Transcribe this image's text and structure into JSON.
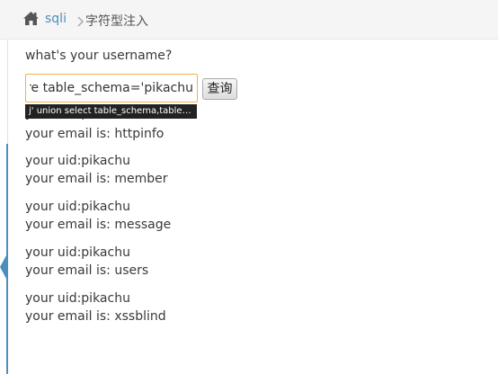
{
  "breadcrumb": {
    "home_icon": "home-icon",
    "link": "sqli",
    "separator_icon": "chevron-right-icon",
    "current": "字符型注入"
  },
  "form": {
    "question": "what's your username?",
    "input_value": "re table_schema='pikachu'#",
    "submit_label": "查询",
    "autocomplete_suggestion": "j' union select table_schema,table_na..."
  },
  "results": [
    {
      "uid": "your uid:pikachu",
      "email": "your email is: httpinfo"
    },
    {
      "uid": "your uid:pikachu",
      "email": "your email is: member"
    },
    {
      "uid": "your uid:pikachu",
      "email": "your email is: message"
    },
    {
      "uid": "your uid:pikachu",
      "email": "your email is: users"
    },
    {
      "uid": "your uid:pikachu",
      "email": "your email is: xssblind"
    }
  ],
  "colors": {
    "link": "#4c8fbd",
    "input_focus_border": "#f5b04c",
    "accent_bar": "#4c8fbd"
  }
}
